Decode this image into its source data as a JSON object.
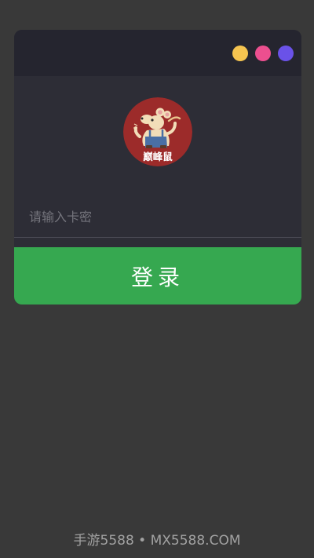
{
  "window_controls": [
    {
      "name": "yellow",
      "color": "#f5c450"
    },
    {
      "name": "pink",
      "color": "#ec4f8f"
    },
    {
      "name": "purple",
      "color": "#6a52e8"
    }
  ],
  "logo": {
    "text": "巅峰鼠",
    "background_color": "#9c2b2a",
    "icon": "mouse-mascot-logo"
  },
  "login_form": {
    "card_key_placeholder": "请输入卡密",
    "card_key_value": "",
    "login_label": "登录",
    "button_color": "#36a850"
  },
  "footer": {
    "watermark_text": "手游5588 • MX5588.COM"
  }
}
